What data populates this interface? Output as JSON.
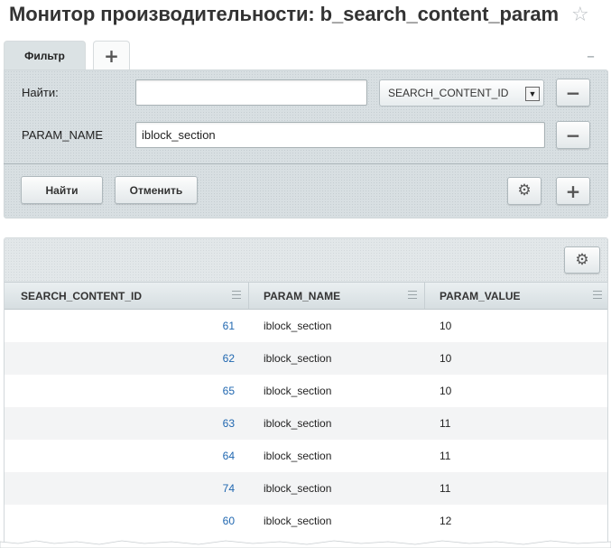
{
  "page": {
    "title": "Монитор производительности: b_search_content_param",
    "favorite_icon": "star-icon"
  },
  "filter": {
    "tabs": [
      {
        "label": "Фильтр",
        "active": true
      }
    ],
    "add_tab_icon": "plus-icon",
    "collapse_icon": "minus-icon",
    "fields": [
      {
        "label": "Найти:",
        "value": "",
        "selector_value": "SEARCH_CONTENT_ID"
      },
      {
        "label": "PARAM_NAME",
        "value": "iblock_section"
      }
    ],
    "find_button": "Найти",
    "cancel_button": "Отменить",
    "settings_icon": "gear-icon",
    "add_field_icon": "plus-icon"
  },
  "grid": {
    "settings_icon": "gear-icon",
    "columns": [
      "SEARCH_CONTENT_ID",
      "PARAM_NAME",
      "PARAM_VALUE"
    ],
    "rows": [
      {
        "id": "61",
        "param_name": "iblock_section",
        "param_value": "10"
      },
      {
        "id": "62",
        "param_name": "iblock_section",
        "param_value": "10"
      },
      {
        "id": "65",
        "param_name": "iblock_section",
        "param_value": "10"
      },
      {
        "id": "63",
        "param_name": "iblock_section",
        "param_value": "11"
      },
      {
        "id": "64",
        "param_name": "iblock_section",
        "param_value": "11"
      },
      {
        "id": "74",
        "param_name": "iblock_section",
        "param_value": "11"
      },
      {
        "id": "60",
        "param_name": "iblock_section",
        "param_value": "12"
      }
    ]
  },
  "colors": {
    "link": "#2067b0",
    "panel_bg": "#d8dfe2",
    "row_alt": "#f3f4f5"
  }
}
